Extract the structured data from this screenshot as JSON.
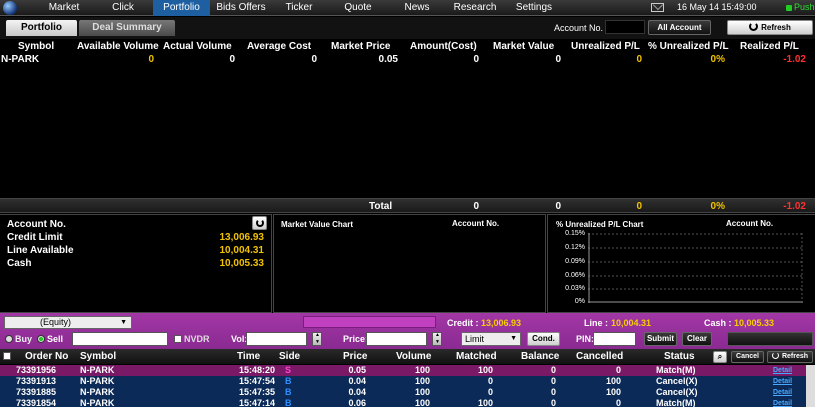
{
  "nav": {
    "items": [
      "Market",
      "Click",
      "Portfolio",
      "Bids Offers",
      "Ticker",
      "Quote",
      "News",
      "Research",
      "Settings"
    ],
    "active_index": 2,
    "datetime": "16 May 14  15:49:00",
    "push_label": "Push"
  },
  "tabs": {
    "portfolio": "Portfolio",
    "deal_summary": "Deal Summary"
  },
  "account": {
    "label": "Account No.",
    "all_account": "All Account",
    "refresh": "Refresh"
  },
  "portfolio": {
    "headers": [
      "Symbol",
      "Available Volume",
      "Actual Volume",
      "Average Cost",
      "Market Price",
      "Amount(Cost)",
      "Market Value",
      "Unrealized P/L",
      "% Unrealized P/L",
      "Realized P/L"
    ],
    "rows": [
      [
        "N-PARK",
        "0",
        "0",
        "0",
        "0.05",
        "0",
        "0",
        "0",
        "0%",
        "-1.02"
      ]
    ],
    "total_label": "Total",
    "totals": {
      "amount_cost": "0",
      "market_value": "0",
      "unrealized": "0",
      "unrealized_pct": "0%",
      "realized": "-1.02"
    }
  },
  "info": {
    "account_label": "Account No.",
    "credit_limit_label": "Credit Limit",
    "credit_limit": "13,006.93",
    "line_available_label": "Line Available",
    "line_available": "10,004.31",
    "cash_label": "Cash",
    "cash": "10,005.33"
  },
  "market_value_chart": {
    "title": "Market Value Chart",
    "account_label": "Account No."
  },
  "unrealized_chart": {
    "title": "% Unrealized P/L Chart",
    "account_label": "Account No.",
    "yticks": [
      "0.15%",
      "0.12%",
      "0.09%",
      "0.06%",
      "0.03%",
      "0%"
    ]
  },
  "order_form": {
    "equity": "(Equity)",
    "credit_label": "Credit :",
    "credit": "13,006.93",
    "line_label": "Line :",
    "line": "10,004.31",
    "cash_label": "Cash :",
    "cash": "10,005.33",
    "buy": "Buy",
    "sell": "Sell",
    "nvdr": "NVDR",
    "vol": "Vol:",
    "price": "Price:",
    "order_type": "Limit",
    "cond": "Cond.",
    "pin": "PIN:",
    "submit": "Submit",
    "clear": "Clear"
  },
  "orders": {
    "headers": [
      "Order No",
      "Symbol",
      "Time",
      "Side",
      "Price",
      "Volume",
      "Matched",
      "Balance",
      "Cancelled",
      "Status"
    ],
    "cancel": "Cancel",
    "refresh": "Refresh",
    "detail": "Detail",
    "rows": [
      [
        "73391956",
        "N-PARK",
        "15:48:20",
        "S",
        "0.05",
        "100",
        "100",
        "0",
        "0",
        "Match(M)"
      ],
      [
        "73391913",
        "N-PARK",
        "15:47:54",
        "B",
        "0.04",
        "100",
        "0",
        "0",
        "100",
        "Cancel(X)"
      ],
      [
        "73391885",
        "N-PARK",
        "15:47:35",
        "B",
        "0.04",
        "100",
        "0",
        "0",
        "100",
        "Cancel(X)"
      ],
      [
        "73391854",
        "N-PARK",
        "15:47:14",
        "B",
        "0.06",
        "100",
        "100",
        "0",
        "0",
        "Match(M)"
      ]
    ]
  },
  "colors": {
    "accent": "#1d5fa0",
    "positive": "#f2c200",
    "negative": "#ff3030",
    "order_bar": "#9a32a0",
    "sell": "#ff44cc",
    "buy": "#2f8fff"
  }
}
